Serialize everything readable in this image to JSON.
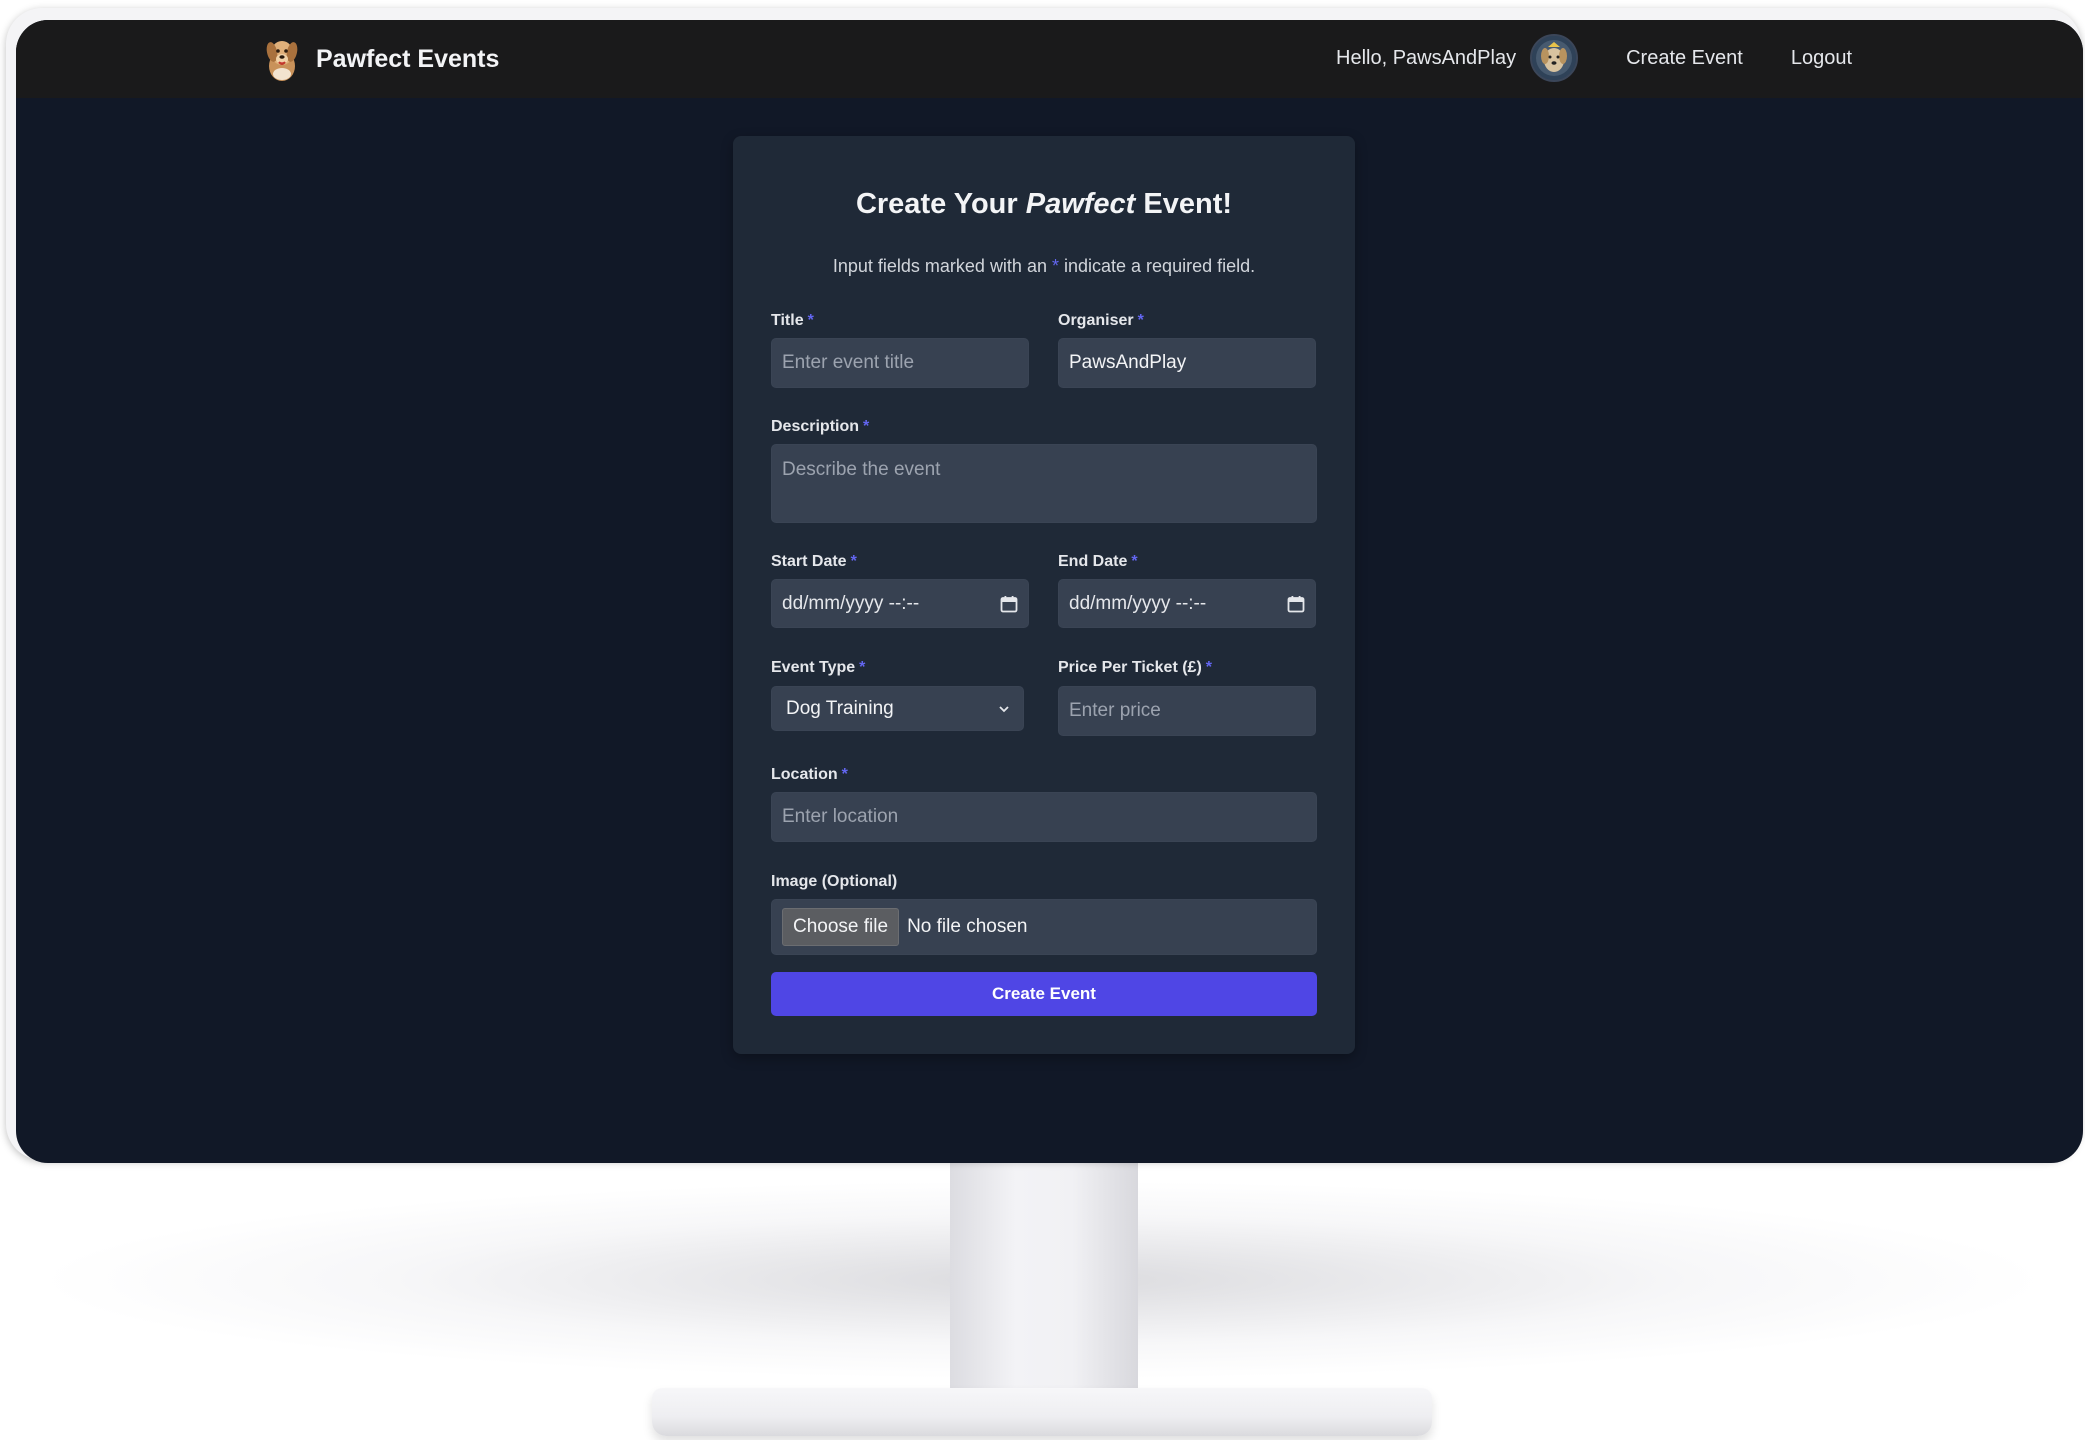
{
  "navbar": {
    "brand_name": "Pawfect Events",
    "greeting": "Hello, PawsAndPlay",
    "create_event_link": "Create Event",
    "logout_link": "Logout"
  },
  "form": {
    "heading_prefix": "Create Your ",
    "heading_emphasis": "Pawfect",
    "heading_suffix": " Event!",
    "note_prefix": "Input fields marked with an ",
    "note_star": "*",
    "note_suffix": " indicate a required field.",
    "required_marker": "*",
    "title": {
      "label": "Title",
      "placeholder": "Enter event title",
      "value": ""
    },
    "organiser": {
      "label": "Organiser",
      "value": "PawsAndPlay"
    },
    "description": {
      "label": "Description",
      "placeholder": "Describe the event"
    },
    "start_date": {
      "label": "Start Date",
      "value": "dd/mm/yyyy --:--"
    },
    "end_date": {
      "label": "End Date",
      "value": "dd/mm/yyyy --:--"
    },
    "event_type": {
      "label": "Event Type",
      "selected": "Dog Training"
    },
    "price": {
      "label": "Price Per Ticket (£)",
      "placeholder": "Enter price"
    },
    "location": {
      "label": "Location",
      "placeholder": "Enter location"
    },
    "image": {
      "label": "Image (Optional)",
      "button": "Choose file",
      "status": "No file chosen"
    },
    "submit_label": "Create Event"
  },
  "colors": {
    "page_background": "#111827",
    "card_background": "#1f2937",
    "navbar_background": "#1a1a1b",
    "accent": "#4f46e5",
    "required_star": "#6366f1"
  },
  "icons": [
    "dog-logo-icon",
    "avatar-dog-image",
    "calendar-icon",
    "chevron-down-icon"
  ]
}
